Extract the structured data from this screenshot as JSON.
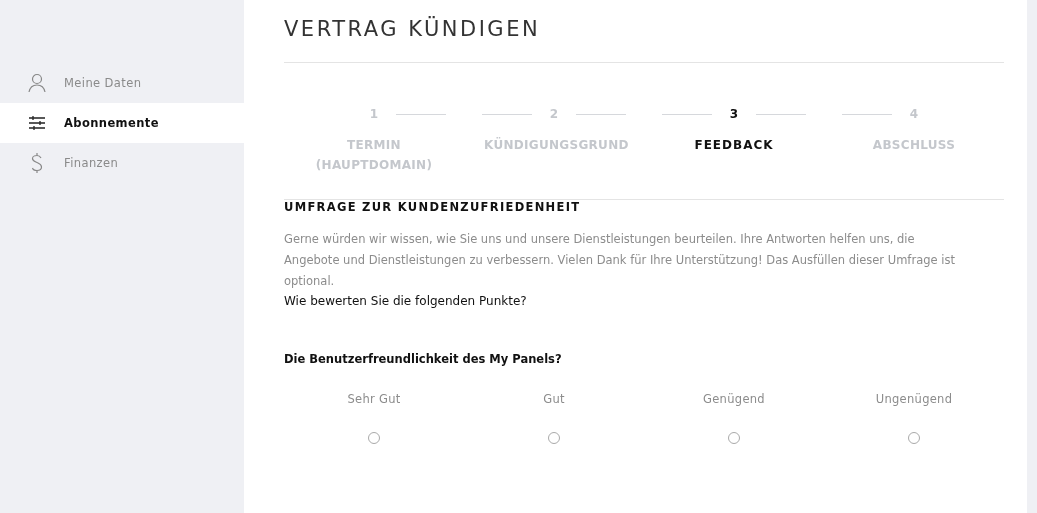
{
  "sidebar": {
    "items": [
      {
        "label": "Meine Daten",
        "selected": false
      },
      {
        "label": "Abonnemente",
        "selected": true
      },
      {
        "label": "Finanzen",
        "selected": false
      }
    ]
  },
  "title": "VERTRAG KÜNDIGEN",
  "steps": [
    {
      "number": "1",
      "label": "TERMIN (HAUPTDOMAIN)",
      "selected": false
    },
    {
      "number": "2",
      "label": "KÜNDIGUNGSGRUND",
      "selected": false
    },
    {
      "number": "3",
      "label": "FEEDBACK",
      "selected": true
    },
    {
      "number": "4",
      "label": "ABSCHLUSS",
      "selected": false
    }
  ],
  "survey": {
    "heading": "UMFRAGE ZUR KUNDENZUFRIEDENHEIT",
    "intro": "Gerne würden wir wissen, wie Sie uns und unsere Dienstleistungen beurteilen. Ihre Antworten helfen uns, die Angebote und Dienstleistungen zu verbessern. Vielen Dank für Ihre Unterstützung! Das Ausfüllen dieser Umfrage ist optional.",
    "prompt": "Wie bewerten Sie die folgenden Punkte?",
    "question": "Die Benutzerfreundlichkeit des My Panels?",
    "options": [
      {
        "label": "Sehr Gut",
        "selected": false
      },
      {
        "label": "Gut",
        "selected": false
      },
      {
        "label": "Genügend",
        "selected": false
      },
      {
        "label": "Ungenügend",
        "selected": false
      }
    ]
  }
}
